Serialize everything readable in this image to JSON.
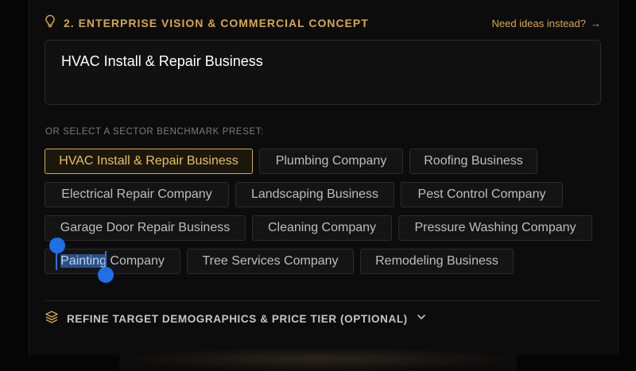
{
  "section": {
    "title": "2. ENTERPRISE VISION & COMMERCIAL CONCEPT",
    "icon": "lightbulb-icon",
    "ideas_link": "Need ideas instead?",
    "ideas_arrow": "→"
  },
  "vision_input": {
    "value": "HVAC Install & Repair Business"
  },
  "presets": {
    "label": "OR SELECT A SECTOR BENCHMARK PRESET:",
    "items": [
      "HVAC Install & Repair Business",
      "Plumbing Company",
      "Roofing Business",
      "Electrical Repair Company",
      "Landscaping Business",
      "Pest Control Company",
      "Garage Door Repair Business",
      "Cleaning Company",
      "Pressure Washing Company",
      "Painting",
      "Tree Services Company",
      "Remodeling Business"
    ],
    "painting_rest": " Company",
    "selected": "HVAC Install & Repair Business"
  },
  "refine": {
    "label": "REFINE TARGET DEMOGRAPHICS & PRICE TIER (OPTIONAL)",
    "icon": "layers-icon",
    "chevron": "chevron-down-icon"
  },
  "colors": {
    "accent": "#d7a84a",
    "background": "#0c0c0c",
    "selection": "#1f6fe6"
  }
}
